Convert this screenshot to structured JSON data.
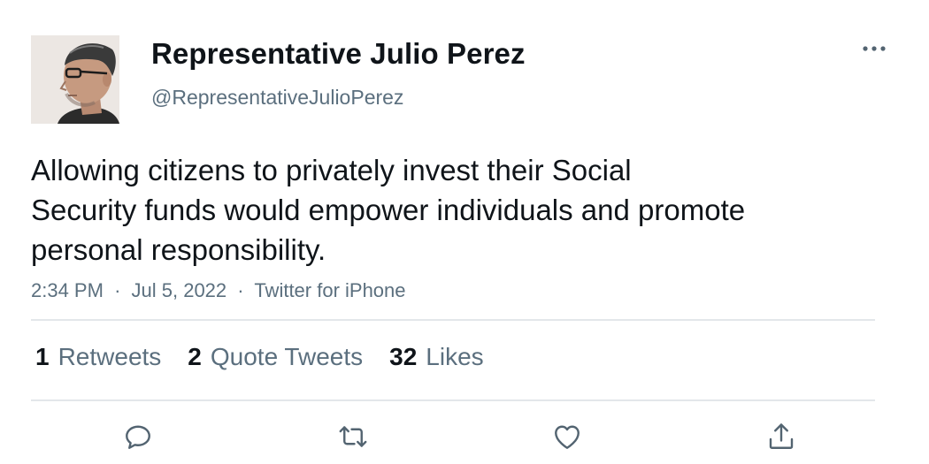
{
  "author": {
    "display_name": "Representative Julio Perez",
    "handle": "@RepresentativeJulioPerez"
  },
  "tweet": {
    "text_lines": [
      "Allowing citizens to privately invest their Social",
      "Security funds would empower individuals and promote",
      "personal responsibility."
    ],
    "time": "2:34 PM",
    "date": "Jul 5, 2022",
    "source": "Twitter for iPhone",
    "separator": "·"
  },
  "stats": {
    "retweets": {
      "count": "1",
      "label": "Retweets"
    },
    "quote_tweets": {
      "count": "2",
      "label": "Quote Tweets"
    },
    "likes": {
      "count": "32",
      "label": "Likes"
    }
  },
  "icons": {
    "more": "more-horizontal-icon",
    "reply": "reply-icon",
    "retweet": "retweet-icon",
    "like": "heart-icon",
    "share": "share-icon"
  },
  "colors": {
    "text_primary": "#0f1419",
    "text_secondary": "#5b6f7e",
    "icon": "#536471",
    "divider": "#e3e7ea"
  }
}
